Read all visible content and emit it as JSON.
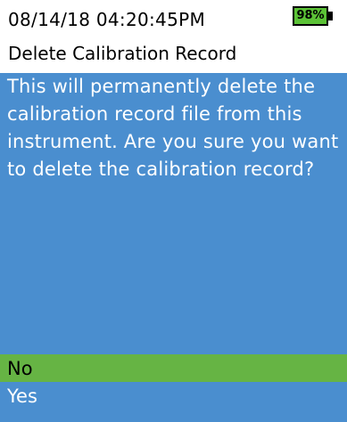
{
  "status": {
    "datetime": "08/14/18 04:20:45PM",
    "battery_level": "98%"
  },
  "screen": {
    "title": "Delete Calibration Record"
  },
  "dialog": {
    "message": "This will permanently delete the calibration record file from this instrument.  Are you sure you want to delete the calibration record?",
    "options": [
      {
        "label": "No",
        "selected": true
      },
      {
        "label": "Yes",
        "selected": false
      }
    ]
  },
  "colors": {
    "panel_background": "#4a8ecf",
    "selection_highlight": "#66b444",
    "battery_fill": "#5bc236"
  },
  "icons": {
    "battery": "battery-icon"
  }
}
